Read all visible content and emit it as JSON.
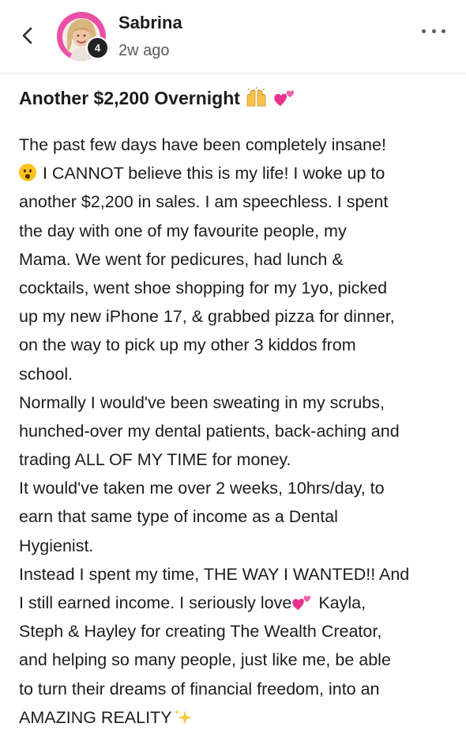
{
  "header": {
    "author_name": "Sabrina",
    "post_time": "2w ago",
    "badge_count": "4",
    "back_icon": "chevron-left-icon",
    "more_icon": "ellipsis-icon",
    "accent_color": "#ec4fa6"
  },
  "post": {
    "title": "Another $2,200 Overnight",
    "title_emojis": [
      "raised-hands-icon",
      "two-hearts-icon"
    ],
    "lines": {
      "l1": "The past few days have been completely insane!",
      "l2": "I CANNOT believe this is my life! I woke up to",
      "l3": "another $2,200 in sales. I am speechless. I spent",
      "l4": "the day with one of my favourite people, my",
      "l5": "Mama. We went for pedicures, had lunch &",
      "l6": "cocktails, went shoe shopping for my 1yo, picked",
      "l7": "up my new iPhone 17, & grabbed pizza for dinner,",
      "l8": "on the way to pick up my other 3 kiddos from",
      "l9": "school.",
      "l10": "Normally I would've been sweating in my scrubs,",
      "l11": "hunched-over my dental patients, back-aching and",
      "l12": "trading ALL OF MY TIME for money.",
      "l13": "It would've taken me over 2 weeks, 10hrs/day, to",
      "l14": "earn that same type of income as a Dental",
      "l15": "Hygienist.",
      "l16": "Instead I spent my time, THE WAY I WANTED!! And",
      "l17a": "I still earned income. I seriously love",
      "l17b": " Kayla,",
      "l18": "Steph & Hayley for creating The Wealth Creator,",
      "l19": "and helping so many people, just like me, be able",
      "l20": "to turn their dreams of financial freedom, into an",
      "l21": "AMAZING REALITY"
    }
  }
}
